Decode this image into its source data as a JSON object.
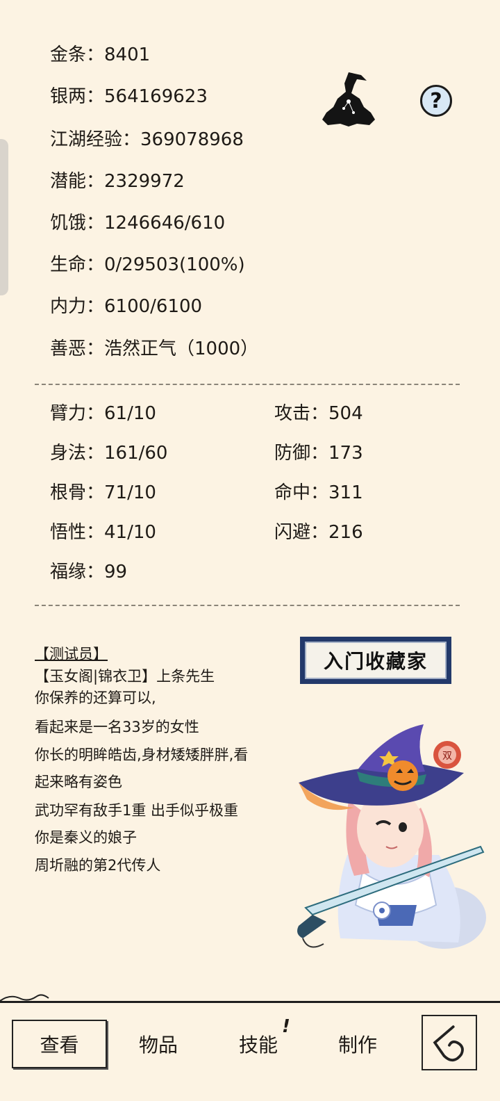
{
  "stats": {
    "gold": "金条：8401",
    "silver": "银两：564169623",
    "exp": "江湖经验：369078968",
    "potential": "潜能：2329972",
    "hunger": "饥饿：1246646/610",
    "life": "生命：0/29503(100%)",
    "internal": "内力：6100/6100",
    "morality": "善恶：浩然正气（1000）"
  },
  "attributes": {
    "strength": "臂力：61/10",
    "agility": "身法：161/60",
    "constitution": "根骨：71/10",
    "intelligence": "悟性：41/10",
    "luck": "福缘：99",
    "attack": "攻击：504",
    "defense": "防御：173",
    "hit": "命中：311",
    "dodge": "闪避：216"
  },
  "help_label": "?",
  "title_badge": "入门收藏家",
  "portrait_badge": "双",
  "description": {
    "rank": "【测试员】",
    "name": "【玉女阁|锦衣卫】上条先生",
    "lines": [
      "你保养的还算可以,",
      "看起来是一名33岁的女性",
      "你长的明眸皓齿,身材矮矮胖胖,看",
      "起来略有姿色",
      "武功罕有敌手1重 出手似乎极重",
      "你是秦义的娘子",
      "周圻融的第2代传人"
    ]
  },
  "nav": {
    "view": "查看",
    "items": "物品",
    "skills": "技能",
    "skills_badge": "!",
    "craft": "制作"
  },
  "icons": {
    "hat": "witch-hat-silhouette-icon",
    "back": "back-arrow-icon",
    "help": "question-icon"
  }
}
